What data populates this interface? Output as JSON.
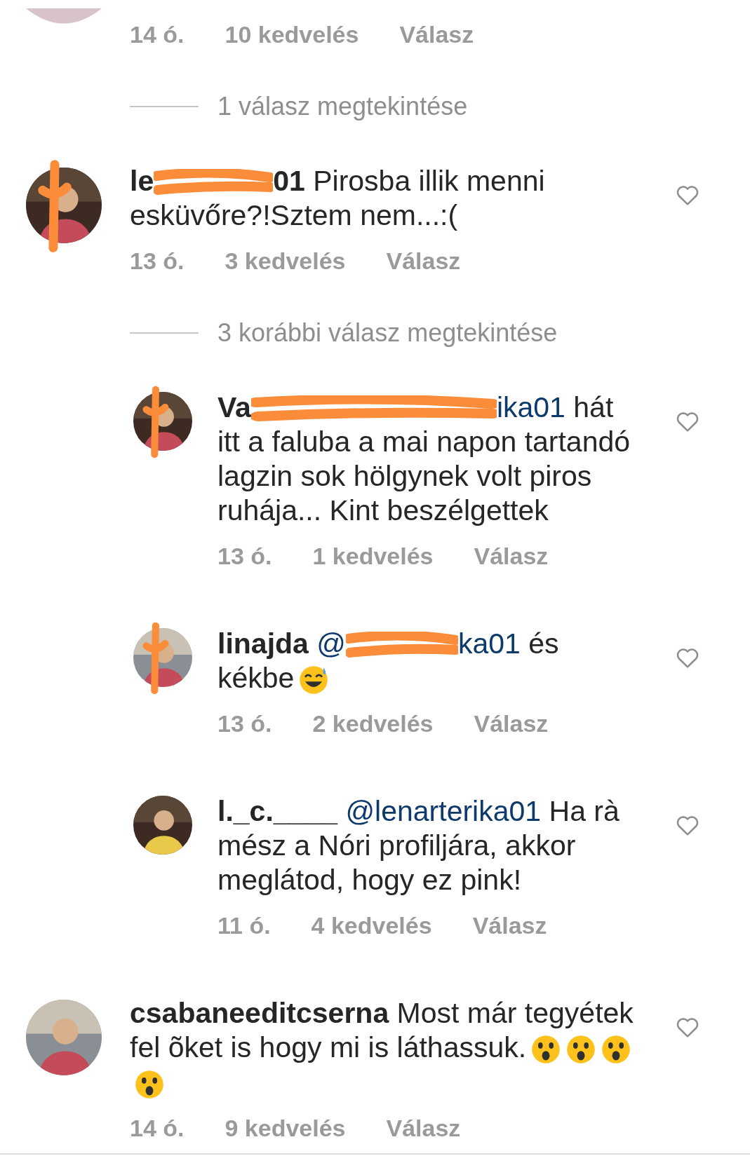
{
  "items": [
    {
      "kind": "comment",
      "meta": {
        "time": "14 ó.",
        "likes": "10 kedvelés",
        "reply": "Válasz"
      }
    },
    {
      "kind": "view_replies",
      "label": "1 válasz megtekintése"
    },
    {
      "kind": "comment",
      "avatar_redacted": true,
      "segments": [
        {
          "kind": "user",
          "text": "le"
        },
        {
          "kind": "redacted"
        },
        {
          "kind": "user",
          "text": "01"
        },
        {
          "kind": "text",
          "text": " Pirosba illik menni esküvőre?!Sztem nem...:("
        }
      ],
      "meta": {
        "time": "13 ó.",
        "likes": "3 kedvelés",
        "reply": "Válasz"
      }
    },
    {
      "kind": "view_replies",
      "label": "3 korábbi válasz megtekintése"
    },
    {
      "kind": "reply",
      "avatar_redacted": true,
      "segments": [
        {
          "kind": "user",
          "text": "Va"
        },
        {
          "kind": "redacted"
        },
        {
          "kind": "mention",
          "text": "ika01"
        },
        {
          "kind": "text",
          "text": " hát itt a faluba a mai napon tartandó lagzin sok hölgynek volt piros ruhája... Kint beszélgettek"
        }
      ],
      "meta": {
        "time": "13 ó.",
        "likes": "1 kedvelés",
        "reply": "Válasz"
      }
    },
    {
      "kind": "reply",
      "avatar_redacted": true,
      "segments": [
        {
          "kind": "user",
          "text": "linajda"
        },
        {
          "kind": "mention",
          "text": "@"
        },
        {
          "kind": "redacted"
        },
        {
          "kind": "mention",
          "text": "ka01"
        },
        {
          "kind": "text",
          "text": " és kékbe"
        },
        {
          "kind": "sweat_emoji"
        }
      ],
      "meta": {
        "time": "13 ó.",
        "likes": "2 kedvelés",
        "reply": "Válasz"
      }
    },
    {
      "kind": "reply",
      "avatar_redacted": false,
      "segments": [
        {
          "kind": "user",
          "text": "l._c.____"
        },
        {
          "kind": "mention",
          "text": "@lenarterika01"
        },
        {
          "kind": "text",
          "text": "  Ha rà mész a Nóri profiljára, akkor meglátod, hogy ez pink!"
        }
      ],
      "meta": {
        "time": "11 ó.",
        "likes": "4 kedvelés",
        "reply": "Válasz"
      }
    },
    {
      "kind": "comment",
      "avatar_redacted": false,
      "segments": [
        {
          "kind": "user",
          "text": "csabaneeditcserna"
        },
        {
          "kind": "text",
          "text": " Most már tegyétek fel õket is hogy mi is láthassuk."
        },
        {
          "kind": "wow_emoji"
        },
        {
          "kind": "wow_emoji"
        },
        {
          "kind": "wow_emoji"
        },
        {
          "kind": "wow_emoji"
        }
      ],
      "meta": {
        "time": "14 ó.",
        "likes": "9 kedvelés",
        "reply": "Válasz"
      }
    }
  ]
}
